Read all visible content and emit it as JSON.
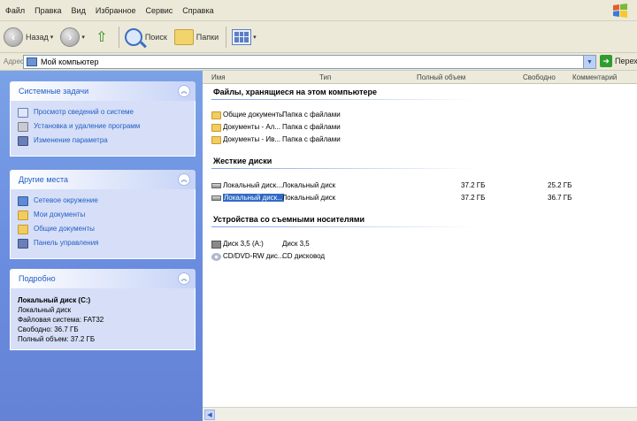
{
  "menu": [
    "Файл",
    "Правка",
    "Вид",
    "Избранное",
    "Сервис",
    "Справка"
  ],
  "toolbar": {
    "back_label": "Назад",
    "search_label": "Поиск",
    "folders_label": "Папки"
  },
  "address": {
    "label": "Адрес:",
    "value": "Мой компьютер",
    "go_label": "Переход"
  },
  "columns": [
    "Имя",
    "Тип",
    "Полный объем",
    "Свободно",
    "Комментарий"
  ],
  "task_panels": {
    "system": {
      "title": "Системные задачи",
      "items": [
        "Просмотр сведений о системе",
        "Установка и удаление программ",
        "Изменение параметра"
      ]
    },
    "other": {
      "title": "Другие места",
      "items": [
        "Сетевое окружение",
        "Мои документы",
        "Общие документы",
        "Панель управления"
      ]
    },
    "details": {
      "title": "Подробно",
      "name": "Локальный диск (C:)",
      "type": "Локальный диск",
      "fs": "Файловая система: FAT32",
      "free": "Свободно: 36.7 ГБ",
      "total": "Полный объем: 37.2 ГБ"
    }
  },
  "groups": {
    "stored": {
      "title": "Файлы, хранящиеся на этом компьютере",
      "rows": [
        {
          "name": "Общие документы",
          "type": "Папка с файлами"
        },
        {
          "name": "Документы - Ал...",
          "type": "Папка с файлами"
        },
        {
          "name": "Документы - Ив...",
          "type": "Папка с файлами"
        }
      ]
    },
    "hdd": {
      "title": "Жесткие диски",
      "rows": [
        {
          "name": "Локальный диск...",
          "type": "Локальный диск",
          "total": "37.2 ГБ",
          "free": "25.2 ГБ"
        },
        {
          "name": "Локальный диск...",
          "type": "Локальный диск",
          "total": "37.2 ГБ",
          "free": "36.7 ГБ"
        }
      ]
    },
    "removable": {
      "title": "Устройства со съемными носителями",
      "rows": [
        {
          "name": "Диск 3,5 (A:)",
          "type": "Диск 3,5"
        },
        {
          "name": "CD/DVD-RW дис...",
          "type": "CD дисковод"
        }
      ]
    }
  },
  "colors": {
    "taskpane": "#6b8ee0",
    "link": "#215dc6",
    "selection": "#316ac5"
  },
  "icons": [
    "back-icon",
    "forward-icon",
    "up-folder-icon",
    "search-icon",
    "folders-icon",
    "views-icon",
    "computer-icon",
    "go-arrow-icon",
    "folder-icon",
    "drive-icon",
    "floppy-icon",
    "cd-icon",
    "collapse-icon"
  ]
}
